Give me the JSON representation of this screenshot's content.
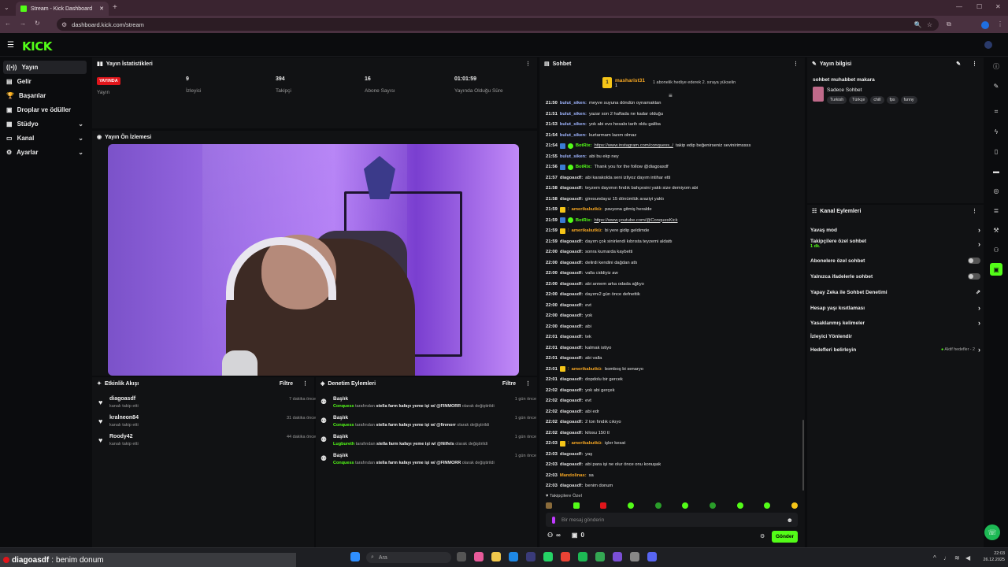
{
  "browser": {
    "tab_title": "Stream - Kick Dashboard",
    "url": "dashboard.kick.com/stream"
  },
  "app": {
    "logo": "KICK",
    "accent": "#53fc18"
  },
  "sidebar": {
    "items": [
      {
        "label": "Yayın",
        "icon": "broadcast-icon"
      },
      {
        "label": "Gelir",
        "icon": "money-icon"
      },
      {
        "label": "Başarılar",
        "icon": "trophy-icon"
      },
      {
        "label": "Droplar ve ödüller",
        "icon": "gift-icon"
      },
      {
        "label": "Stüdyo",
        "icon": "studio-icon"
      },
      {
        "label": "Kanal",
        "icon": "channel-icon"
      },
      {
        "label": "Ayarlar",
        "icon": "gear-icon"
      }
    ]
  },
  "stats": {
    "title": "Yayın İstatistikleri",
    "live_badge": "YAYINDA",
    "live_label": "Yayın",
    "items": [
      {
        "value": "9",
        "label": "İzleyici"
      },
      {
        "value": "394",
        "label": "Takipçi"
      },
      {
        "value": "16",
        "label": "Abone Sayısı"
      },
      {
        "value": "01:01:59",
        "label": "Yayında Olduğu Süre"
      }
    ]
  },
  "preview": {
    "title": "Yayın Ön İzlemesi"
  },
  "activity": {
    "title": "Etkinlik Akışı",
    "filter": "Filtre",
    "items": [
      {
        "name": "diagoasdf",
        "sub": "kanalı takip etti",
        "time": "7 dakika önce"
      },
      {
        "name": "kralneon84",
        "sub": "kanalı takip etti",
        "time": "31 dakika önce"
      },
      {
        "name": "Roody42",
        "sub": "kanalı takip etti",
        "time": "44 dakika önce"
      }
    ]
  },
  "moderation": {
    "title": "Denetim Eylemleri",
    "filter": "Filtre",
    "items": [
      {
        "title": "Başlık",
        "actor": "Conquess",
        "mid": "tarafından",
        "value": "stella farm kafayı yeme işi w/ @FINMORR",
        "end": "olarak değiştirildi",
        "time": "1 gün önce"
      },
      {
        "title": "Başlık",
        "actor": "Conquess",
        "mid": "tarafından",
        "value": "stella farm kafayı yeme işi w/ @finmorr",
        "end": "olarak değiştirildi",
        "time": "1 gün önce"
      },
      {
        "title": "Başlık",
        "actor": "Lugbureth",
        "mid": "tarafından",
        "value": "stella farm kafayı yeme işi w/ @Nilfels",
        "end": "olarak değiştirildi",
        "time": "1 gün önce"
      },
      {
        "title": "Başlık",
        "actor": "Conquess",
        "mid": "tarafından",
        "value": "stella farm kafayı yeme işi w/ @FINMORR",
        "end": "olarak değiştirildi",
        "time": "1 gün önce"
      }
    ]
  },
  "chat": {
    "title": "Sohbet",
    "pinned_user": "masharist31",
    "pinned_count": "1",
    "pinned_text": "1 abonelik hediye ederek 2. sıraya yükselin",
    "messages": [
      {
        "time": "21:50",
        "user": "bulut_siken:",
        "text": "meyve suyuna döndün oynamaktan",
        "color": "#9fb5ff"
      },
      {
        "time": "21:51",
        "user": "bulut_siken:",
        "text": "yazar son 2 haftada ne kadar olduğu",
        "color": "#9fb5ff"
      },
      {
        "time": "21:53",
        "user": "bulut_siken:",
        "text": "yok abi evo hesabı tarih oldu galiba",
        "color": "#9fb5ff"
      },
      {
        "time": "21:54",
        "user": "bulut_siken:",
        "text": "kurtarmam lazım olmaz",
        "color": "#9fb5ff"
      },
      {
        "time": "21:54",
        "user": "BotRix:",
        "text": "https://www.instagram.com/conquess_/",
        "text2": "takip edip beğenirseniz sevinirimssss",
        "color": "#53fc18",
        "bot": true,
        "link": true
      },
      {
        "time": "21:55",
        "user": "bulut_siken:",
        "text": "abi bu ekp ney",
        "color": "#9fb5ff"
      },
      {
        "time": "21:56",
        "user": "BotRix:",
        "text": "Thank you for the follow @diagoasdf",
        "color": "#53fc18",
        "bot": true
      },
      {
        "time": "21:57",
        "user": "diagoasdf:",
        "text": "abi karakolda seni izliyoz dayım intihar etti",
        "color": "#dddddd"
      },
      {
        "time": "21:58",
        "user": "diagoasdf:",
        "text": "teyzem dayımın fındık bahçesini yaktı size demiyom abi",
        "color": "#dddddd"
      },
      {
        "time": "21:58",
        "user": "diagoasdf:",
        "text": "giresundayız 15 dönümlük araziyi yaktı",
        "color": "#dddddd"
      },
      {
        "time": "21:59",
        "user": "amerikalıutkü:",
        "text": "pavyona gitmiş heralde",
        "color": "#f5a623",
        "crown": true
      },
      {
        "time": "21:59",
        "user": "BotRix:",
        "text": "https://www.youtube.com/@ConquesKick",
        "color": "#53fc18",
        "bot": true,
        "link": true
      },
      {
        "time": "21:59",
        "user": "amerikalıutkü:",
        "text": "bi yere gidip geldimde",
        "color": "#f5a623",
        "crown": true
      },
      {
        "time": "21:59",
        "user": "diagoasdf:",
        "text": "dayım çok sinirlendi kıbrısta teyzemi aldattı",
        "color": "#dddddd"
      },
      {
        "time": "22:00",
        "user": "diagoasdf:",
        "text": "sonra kumarda kaybetti",
        "color": "#dddddd"
      },
      {
        "time": "22:00",
        "user": "diagoasdf:",
        "text": "delirdi kendini dağdan attı",
        "color": "#dddddd"
      },
      {
        "time": "22:00",
        "user": "diagoasdf:",
        "text": "valla ciddiyiz aw",
        "color": "#dddddd"
      },
      {
        "time": "22:00",
        "user": "diagoasdf:",
        "text": "abi annem arka odada ağlıyo",
        "color": "#dddddd"
      },
      {
        "time": "22:00",
        "user": "diagoasdf:",
        "text": "dayımı2 gün önce defnettik",
        "color": "#dddddd"
      },
      {
        "time": "22:00",
        "user": "diagoasdf:",
        "text": "evt",
        "color": "#dddddd"
      },
      {
        "time": "22:00",
        "user": "diagoasdf:",
        "text": "yok",
        "color": "#dddddd"
      },
      {
        "time": "22:00",
        "user": "diagoasdf:",
        "text": "abi",
        "color": "#dddddd"
      },
      {
        "time": "22:01",
        "user": "diagoasdf:",
        "text": "tek",
        "color": "#dddddd"
      },
      {
        "time": "22:01",
        "user": "diagoasdf:",
        "text": "kalmak istiyo",
        "color": "#dddddd"
      },
      {
        "time": "22:01",
        "user": "diagoasdf:",
        "text": "abi valla",
        "color": "#dddddd"
      },
      {
        "time": "22:01",
        "user": "amerikalıutkü:",
        "text": "bomboş bi senaryo",
        "color": "#f5a623",
        "crown": true
      },
      {
        "time": "22:01",
        "user": "diagoasdf:",
        "text": "dopdolu bir gercek",
        "color": "#dddddd"
      },
      {
        "time": "22:02",
        "user": "diagoasdf:",
        "text": "yok abi gerçek",
        "color": "#dddddd"
      },
      {
        "time": "22:02",
        "user": "diagoasdf:",
        "text": "evt",
        "color": "#dddddd"
      },
      {
        "time": "22:02",
        "user": "diagoasdf:",
        "text": "abi edr",
        "color": "#dddddd"
      },
      {
        "time": "22:02",
        "user": "diagoasdf:",
        "text": "2 ton fındık cıkıyo",
        "color": "#dddddd"
      },
      {
        "time": "22:02",
        "user": "diagoasdf:",
        "text": "kilosu 150 tl",
        "color": "#dddddd"
      },
      {
        "time": "22:03",
        "user": "amerikalıutkü:",
        "text": "işler kesat",
        "color": "#f5a623",
        "crown": true
      },
      {
        "time": "22:03",
        "user": "diagoasdf:",
        "text": "yaş",
        "color": "#dddddd"
      },
      {
        "time": "22:03",
        "user": "diagoasdf:",
        "text": "abi para işi ne olur önce onu konuşak",
        "color": "#dddddd"
      },
      {
        "time": "22:03",
        "user": "Mandolinas:",
        "text": "sa",
        "color": "#f5a623"
      },
      {
        "time": "22:03",
        "user": "diagoasdf:",
        "text": "benim donum",
        "color": "#dddddd"
      }
    ],
    "followers_only": "Takipçilere Özel",
    "input_placeholder": "Bir mesaj gönderin",
    "send_label": "Gönder",
    "infinity": "∞",
    "counter": "0"
  },
  "stream_info": {
    "title": "Yayın bilgisi",
    "stream_title": "sohbet muhabbet makara",
    "category": "Sadece Sohbet",
    "tags": [
      "Turkish",
      "Türkçe",
      "chill",
      "fps",
      "funny"
    ]
  },
  "channel_actions": {
    "title": "Kanal Eylemleri",
    "items": [
      {
        "label": "Yavaş mod",
        "control": "arrow"
      },
      {
        "label": "Takipçilere özel sohbet",
        "extra": "1 dk.",
        "control": "arrow"
      },
      {
        "label": "Abonelere özel sohbet",
        "control": "toggle"
      },
      {
        "label": "Yalnızca ifadelerle sohbet",
        "control": "toggle"
      },
      {
        "label": "Yapay Zeka ile Sohbet Denetimi",
        "control": "external"
      },
      {
        "label": "Hesap yaşı kısıtlaması",
        "control": "arrow"
      },
      {
        "label": "Yasaklanmış kelimeler",
        "control": "arrow"
      },
      {
        "label": "İzleyici Yönlendir",
        "control": "none"
      },
      {
        "label": "Hedefleri belirleyin",
        "extra": "Aktif hedefler - 2",
        "control": "arrow"
      }
    ]
  },
  "taskbar": {
    "preview_user": "diagoasdf",
    "preview_text": "benim donum",
    "search_placeholder": "Ara",
    "time": "22:03",
    "date": "26.12.2025"
  }
}
